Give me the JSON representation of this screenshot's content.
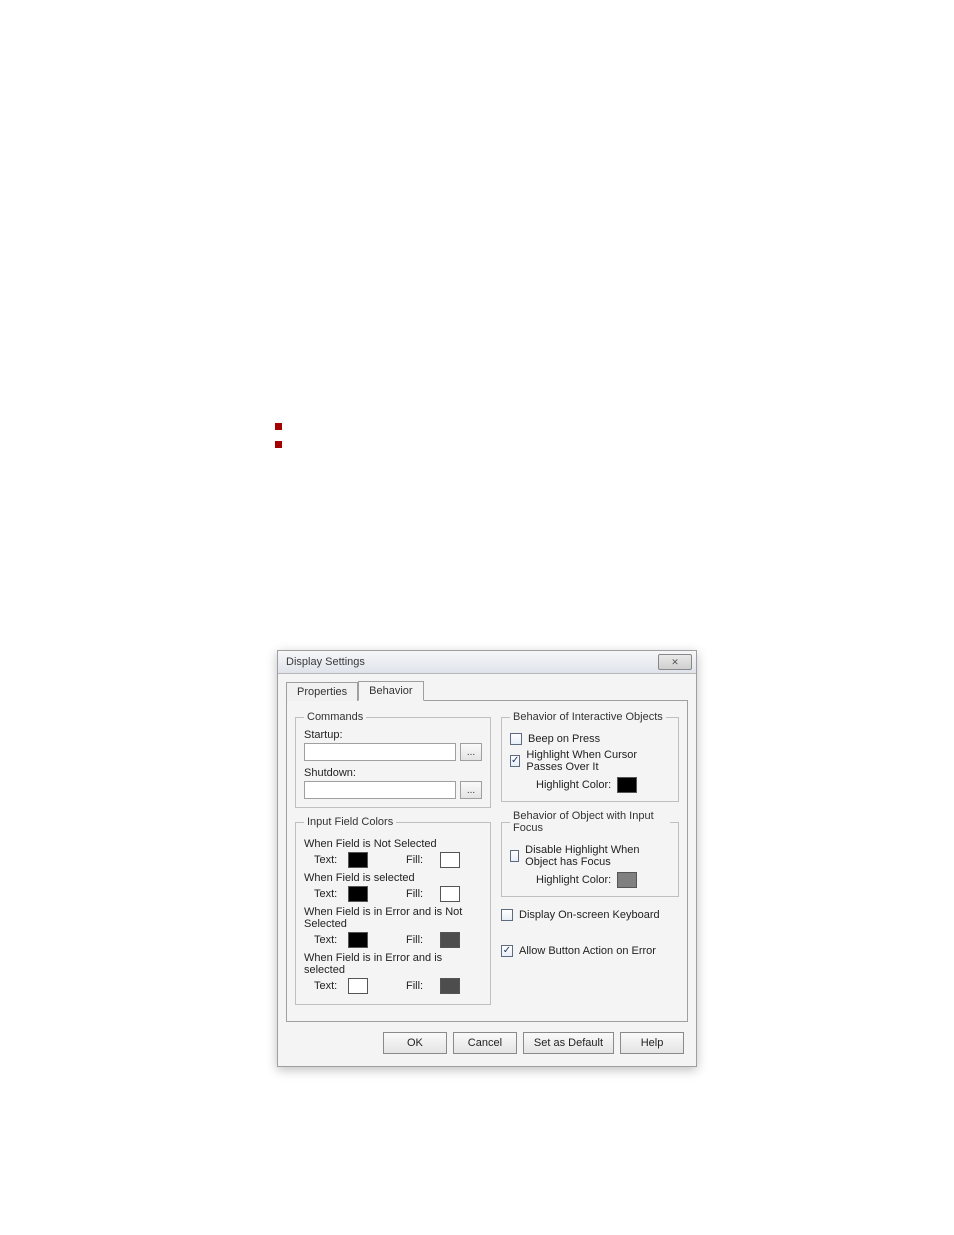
{
  "bullets": [
    " ",
    " ",
    " ",
    " ",
    " ",
    " "
  ],
  "dialog": {
    "title": "Display Settings",
    "tabs": {
      "properties": "Properties",
      "behavior": "Behavior"
    },
    "commands": {
      "legend": "Commands",
      "startup_label": "Startup:",
      "startup_value": "",
      "shutdown_label": "Shutdown:",
      "shutdown_value": "",
      "browse_label": "..."
    },
    "colors_group": {
      "legend": "Input Field Colors",
      "not_selected_heading": "When Field is Not Selected",
      "selected_heading": "When Field is selected",
      "error_not_selected_heading": "When Field is in Error and is Not Selected",
      "error_selected_heading": "When Field is in Error and is selected",
      "text_label": "Text:",
      "fill_label": "Fill:",
      "not_selected_text": "#000000",
      "not_selected_fill": "#ffffff",
      "selected_text": "#000000",
      "selected_fill": "#ffffff",
      "error_not_selected_text": "#000000",
      "error_not_selected_fill": "#4d4d4d",
      "error_selected_text": "#ffffff",
      "error_selected_fill": "#4d4d4d"
    },
    "interactive_group": {
      "legend": "Behavior of Interactive Objects",
      "beep_label": "Beep on Press",
      "beep_checked": false,
      "highlight_hover_label": "Highlight When Cursor Passes Over It",
      "highlight_hover_checked": true,
      "highlight_color_label": "Highlight Color:",
      "highlight_color": "#000000"
    },
    "focus_group": {
      "legend": "Behavior of Object with Input Focus",
      "disable_label": "Disable Highlight When Object has Focus",
      "disable_checked": false,
      "highlight_color_label": "Highlight Color:",
      "highlight_color": "#808080"
    },
    "onscreen_kb": {
      "label": "Display On-screen Keyboard",
      "checked": false
    },
    "allow_button_error": {
      "label": "Allow Button Action on Error",
      "checked": true
    },
    "buttons": {
      "ok": "OK",
      "cancel": "Cancel",
      "set_default": "Set as Default",
      "help": "Help"
    },
    "check_glyph": "✓"
  }
}
